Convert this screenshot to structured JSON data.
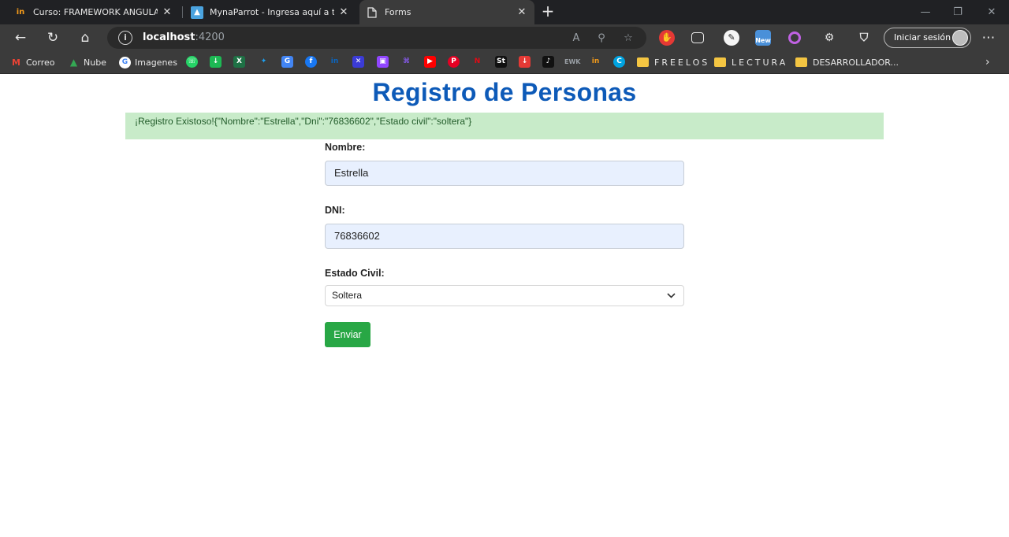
{
  "browser": {
    "tabs": [
      {
        "title": "Curso: FRAMEWORK ANGULAR (",
        "favicon": "in-logo-icon",
        "color": "#f49b1a"
      },
      {
        "title": "MynaParrot - Ingresa aquí a tu cl",
        "favicon": "mynaparrot-icon",
        "color": "#4aa3df"
      },
      {
        "title": "Forms",
        "favicon": "page-icon",
        "active": true
      }
    ],
    "address": {
      "host": "localhost",
      "port": ":4200"
    },
    "signin_label": "Iniciar sesión",
    "bookmarks": [
      {
        "label": "Correo",
        "icon": "gmail-icon"
      },
      {
        "label": "Nube",
        "icon": "drive-icon"
      },
      {
        "label": "Imagenes",
        "icon": "google-icon"
      }
    ],
    "folders": [
      "FREELOS",
      "LECTURA",
      "DESARROLLADOR..."
    ],
    "ext_badge": "New"
  },
  "page": {
    "title": "Registro de Personas",
    "alert": "¡Registro Existoso!{\"Nombre\":\"Estrella\",\"Dni\":\"76836602\",\"Estado civil\":\"soltera\"}",
    "alert_color": "#c8ebc9",
    "form": {
      "nombre_label": "Nombre:",
      "nombre_value": "Estrella",
      "dni_label": "DNI:",
      "dni_value": "76836602",
      "estado_label": "Estado Civil:",
      "estado_value": "Soltera",
      "submit_label": "Enviar"
    },
    "accent": "#0d5ab8",
    "button_color": "#28a745"
  }
}
